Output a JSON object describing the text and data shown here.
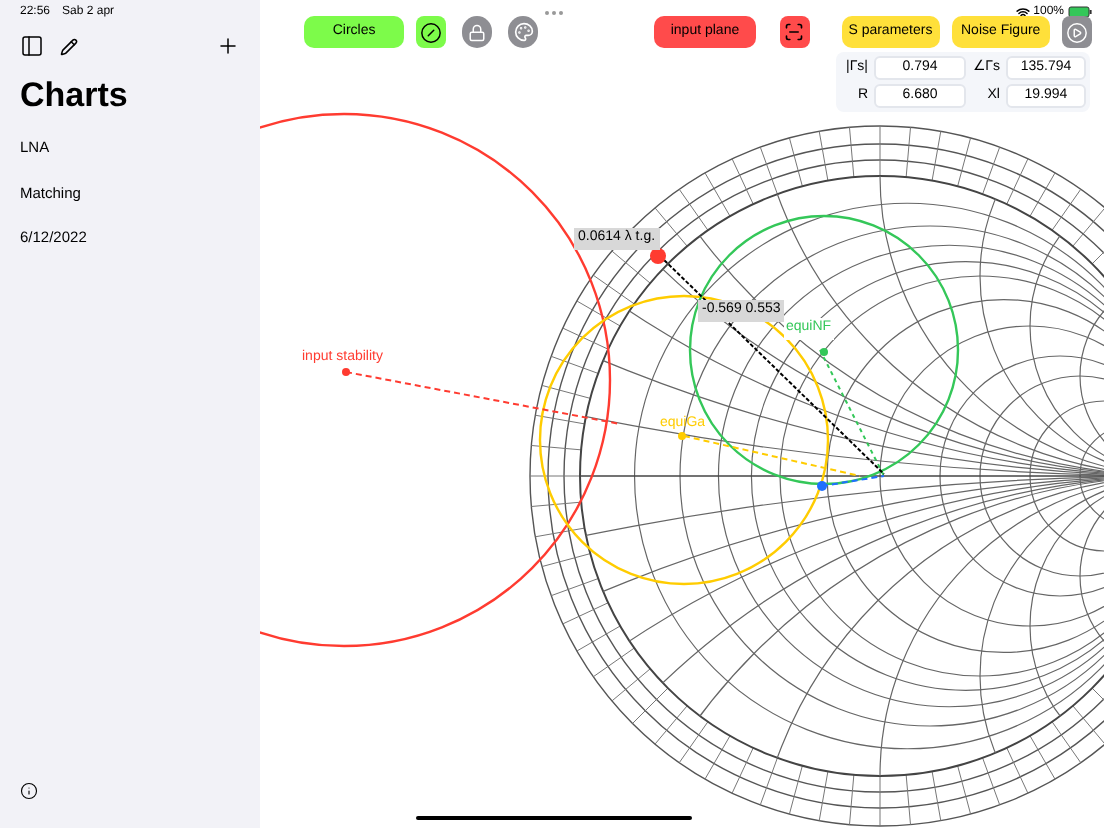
{
  "status_bar": {
    "time": "22:56",
    "date": "Sab 2 apr",
    "battery": "100%"
  },
  "sidebar": {
    "title": "Charts",
    "items": [
      {
        "label": "LNA"
      },
      {
        "label": "Matching"
      },
      {
        "label": "6/12/2022"
      }
    ]
  },
  "toolbar": {
    "circles": "Circles",
    "input_plane": "input plane",
    "s_parameters": "S parameters",
    "noise_figure": "Noise Figure"
  },
  "readouts": [
    {
      "label": "|Γs|",
      "value": "0.794"
    },
    {
      "label": "∠Γs",
      "value": "135.794"
    },
    {
      "label": "R",
      "value": "6.680"
    },
    {
      "label": "Xl",
      "value": "19.994"
    }
  ],
  "circles": [
    {
      "label": "input stability",
      "color": "#ff3b30"
    },
    {
      "label": "equiGa",
      "color": "#ffcc00"
    },
    {
      "label": "equiNF",
      "color": "#34c759"
    }
  ],
  "point_labels": [
    "0.0614 λ t.g.",
    "-0.569 0.553"
  ]
}
